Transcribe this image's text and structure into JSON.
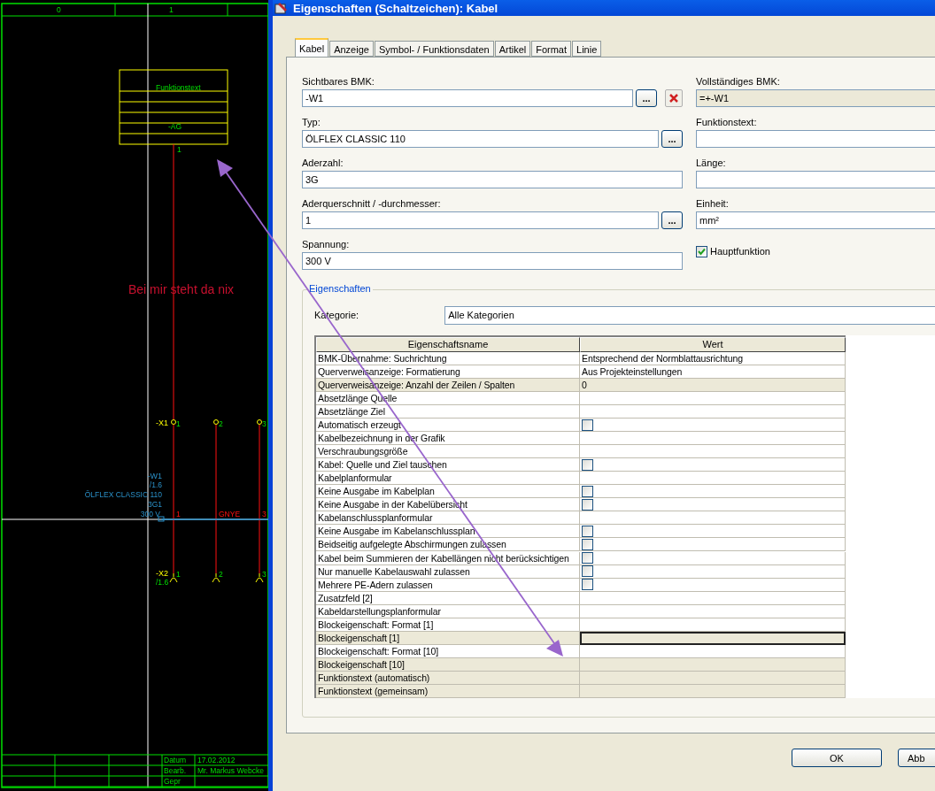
{
  "schematic": {
    "column_numbers": [
      "0",
      "1"
    ],
    "block_texts": [
      "Funktionstext",
      "-AG"
    ],
    "wire_number": "1",
    "note": "Bei mir steht da nix",
    "terminals_top": {
      "name": "-X1",
      "pins": [
        "1",
        "2",
        "3"
      ]
    },
    "cable": {
      "bmk": "-W1",
      "ref": "/1.6",
      "type": "ÖLFLEX CLASSIC 110",
      "cores": "3G1",
      "voltage": "300 V",
      "core_labels": [
        "1",
        "GNYE",
        "3"
      ]
    },
    "terminals_bottom": {
      "name": "-X2",
      "ref": "/1.6",
      "pins": [
        "1",
        "2",
        "3"
      ]
    },
    "title_block": [
      {
        "label": "Datum",
        "value": "17.02.2012"
      },
      {
        "label": "Bearb.",
        "value": "Mr. Markus Webcke"
      },
      {
        "label": "Gepr"
      }
    ]
  },
  "dialog": {
    "title": "Eigenschaften (Schaltzeichen): Kabel",
    "tabs": [
      {
        "label": "Kabel",
        "selected": true
      },
      {
        "label": "Anzeige",
        "selected": false
      },
      {
        "label": "Symbol- / Funktionsdaten",
        "selected": false
      },
      {
        "label": "Artikel",
        "selected": false
      },
      {
        "label": "Format",
        "selected": false
      },
      {
        "label": "Linie",
        "selected": false
      }
    ],
    "left_fields": [
      {
        "label": "Sichtbares BMK:",
        "value": "-W1",
        "browse": "...",
        "delete": true
      },
      {
        "label": "Typ:",
        "value": "ÖLFLEX CLASSIC 110",
        "browse": "..."
      },
      {
        "label": "Aderzahl:",
        "value": "3G"
      },
      {
        "label": "Aderquerschnitt / -durchmesser:",
        "value": "1",
        "browse": "..."
      },
      {
        "label": "Spannung:",
        "value": "300 V"
      }
    ],
    "right_fields": [
      {
        "label": "Vollständiges BMK:",
        "value": "=+-W1",
        "readonly": true
      },
      {
        "label": "Funktionstext:",
        "readonly": false
      },
      {
        "label": "Länge:",
        "readonly": false
      },
      {
        "label": "Einheit:",
        "value": "mm²",
        "readonly": false
      }
    ],
    "main_function": {
      "label": "Hauptfunktion",
      "checked": true
    },
    "group_title": "Eigenschaften",
    "category": {
      "label": "Kategorie:",
      "value": "Alle Kategorien"
    },
    "table": {
      "columns": [
        "Eigenschaftsname",
        "Wert"
      ],
      "rows": [
        {
          "name": "BMK-Übernahme: Suchrichtung",
          "kind": "text",
          "value": "Entsprechend der Normblattausrichtung",
          "readonly": false,
          "selected": false
        },
        {
          "name": "Querverweisanzeige: Formatierung",
          "kind": "text",
          "value": "Aus Projekteinstellungen",
          "readonly": false,
          "selected": false
        },
        {
          "name": "Querverweisanzeige: Anzahl der Zeilen / Spalten",
          "kind": "text",
          "value": "0",
          "readonly": true,
          "selected": false
        },
        {
          "name": "Absetzlänge Quelle",
          "kind": "text",
          "readonly": false,
          "selected": false
        },
        {
          "name": "Absetzlänge Ziel",
          "kind": "text",
          "readonly": false,
          "selected": false
        },
        {
          "name": "Automatisch erzeugt",
          "kind": "checkbox",
          "checked": false,
          "readonly": false,
          "selected": false
        },
        {
          "name": "Kabelbezeichnung in der Grafik",
          "kind": "text",
          "readonly": false,
          "selected": false
        },
        {
          "name": "Verschraubungsgröße",
          "kind": "text",
          "readonly": false,
          "selected": false
        },
        {
          "name": "Kabel: Quelle und Ziel tauschen",
          "kind": "checkbox",
          "checked": false,
          "readonly": false,
          "selected": false
        },
        {
          "name": "Kabelplanformular",
          "kind": "text",
          "readonly": false,
          "selected": false
        },
        {
          "name": "Keine Ausgabe im Kabelplan",
          "kind": "checkbox",
          "checked": false,
          "readonly": false,
          "selected": false
        },
        {
          "name": "Keine Ausgabe in der Kabelübersicht",
          "kind": "checkbox",
          "checked": false,
          "readonly": false,
          "selected": false
        },
        {
          "name": "Kabelanschlussplanformular",
          "kind": "text",
          "readonly": false,
          "selected": false
        },
        {
          "name": "Keine Ausgabe im  Kabelanschlussplan",
          "kind": "checkbox",
          "checked": false,
          "readonly": false,
          "selected": false
        },
        {
          "name": "Beidseitig aufgelegte Abschirmungen zulassen",
          "kind": "checkbox",
          "checked": false,
          "readonly": false,
          "selected": false
        },
        {
          "name": "Kabel beim Summieren der Kabellängen nicht berücksichtigen",
          "kind": "checkbox",
          "checked": false,
          "readonly": false,
          "selected": false
        },
        {
          "name": "Nur manuelle Kabelauswahl zulassen",
          "kind": "checkbox",
          "checked": false,
          "readonly": false,
          "selected": false
        },
        {
          "name": "Mehrere PE-Adern zulassen",
          "kind": "checkbox",
          "checked": false,
          "readonly": false,
          "selected": false
        },
        {
          "name": "Zusatzfeld [2]",
          "kind": "text",
          "readonly": false,
          "selected": false
        },
        {
          "name": "Kabeldarstellungsplanformular",
          "kind": "text",
          "readonly": false,
          "selected": false
        },
        {
          "name": "Blockeigenschaft: Format [1]",
          "kind": "text",
          "readonly": false,
          "selected": false
        },
        {
          "name": "Blockeigenschaft [1]",
          "kind": "text",
          "readonly": true,
          "selected": true
        },
        {
          "name": "Blockeigenschaft: Format [10]",
          "kind": "text",
          "readonly": false,
          "selected": false
        },
        {
          "name": "Blockeigenschaft [10]",
          "kind": "text",
          "readonly": true,
          "selected": false
        },
        {
          "name": "Funktionstext (automatisch)",
          "kind": "text",
          "readonly": true,
          "selected": false
        },
        {
          "name": "Funktionstext (gemeinsam)",
          "kind": "text",
          "readonly": true,
          "selected": false
        }
      ]
    },
    "buttons": [
      "OK",
      "Abb"
    ]
  }
}
